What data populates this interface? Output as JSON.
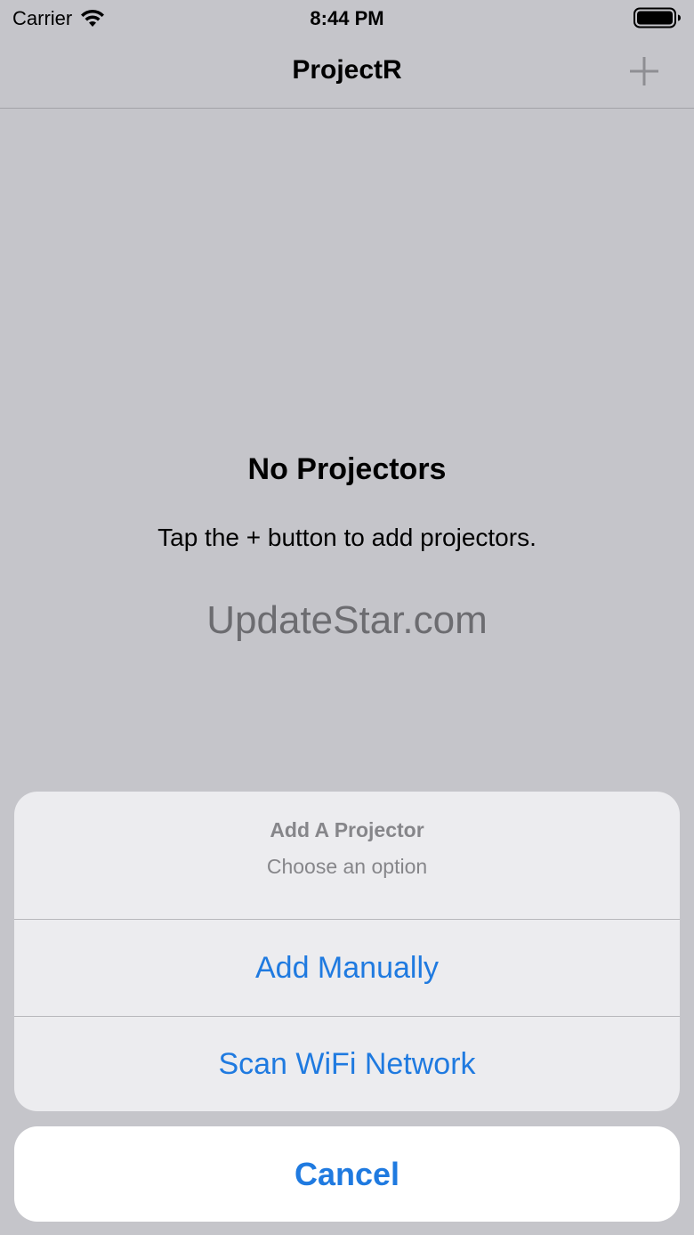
{
  "status_bar": {
    "carrier": "Carrier",
    "time": "8:44 PM",
    "icons": [
      "wifi-icon",
      "battery-icon"
    ]
  },
  "nav": {
    "title": "ProjectR",
    "add_icon": "plus-icon"
  },
  "empty_state": {
    "title": "No Projectors",
    "message": "Tap the + button to add projectors."
  },
  "watermark": "UpdateStar.com",
  "action_sheet": {
    "title": "Add A Projector",
    "message": "Choose an option",
    "actions": [
      "Add Manually",
      "Scan WiFi Network"
    ],
    "cancel": "Cancel"
  },
  "colors": {
    "accent": "#1f7ae0",
    "dimmed_background": "#c5c5ca",
    "sheet_background": "#ececef"
  }
}
